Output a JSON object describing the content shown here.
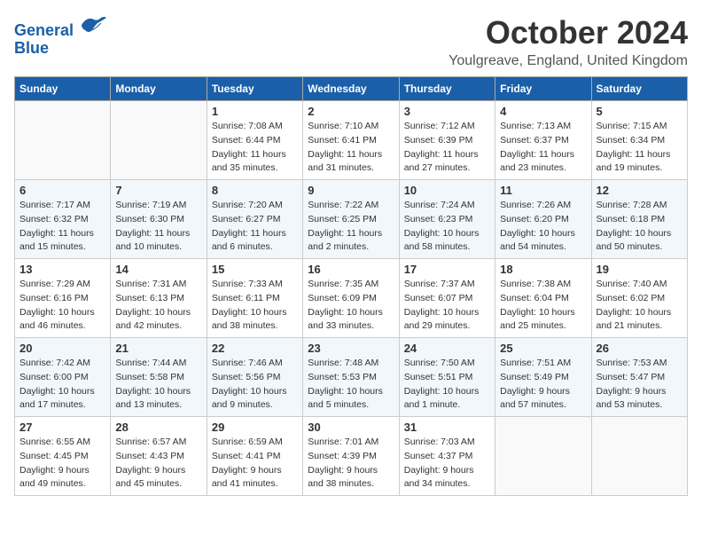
{
  "header": {
    "logo_line1": "General",
    "logo_line2": "Blue",
    "month": "October 2024",
    "location": "Youlgreave, England, United Kingdom"
  },
  "days_of_week": [
    "Sunday",
    "Monday",
    "Tuesday",
    "Wednesday",
    "Thursday",
    "Friday",
    "Saturday"
  ],
  "weeks": [
    [
      {
        "day": "",
        "sunrise": "",
        "sunset": "",
        "daylight": ""
      },
      {
        "day": "",
        "sunrise": "",
        "sunset": "",
        "daylight": ""
      },
      {
        "day": "1",
        "sunrise": "Sunrise: 7:08 AM",
        "sunset": "Sunset: 6:44 PM",
        "daylight": "Daylight: 11 hours and 35 minutes."
      },
      {
        "day": "2",
        "sunrise": "Sunrise: 7:10 AM",
        "sunset": "Sunset: 6:41 PM",
        "daylight": "Daylight: 11 hours and 31 minutes."
      },
      {
        "day": "3",
        "sunrise": "Sunrise: 7:12 AM",
        "sunset": "Sunset: 6:39 PM",
        "daylight": "Daylight: 11 hours and 27 minutes."
      },
      {
        "day": "4",
        "sunrise": "Sunrise: 7:13 AM",
        "sunset": "Sunset: 6:37 PM",
        "daylight": "Daylight: 11 hours and 23 minutes."
      },
      {
        "day": "5",
        "sunrise": "Sunrise: 7:15 AM",
        "sunset": "Sunset: 6:34 PM",
        "daylight": "Daylight: 11 hours and 19 minutes."
      }
    ],
    [
      {
        "day": "6",
        "sunrise": "Sunrise: 7:17 AM",
        "sunset": "Sunset: 6:32 PM",
        "daylight": "Daylight: 11 hours and 15 minutes."
      },
      {
        "day": "7",
        "sunrise": "Sunrise: 7:19 AM",
        "sunset": "Sunset: 6:30 PM",
        "daylight": "Daylight: 11 hours and 10 minutes."
      },
      {
        "day": "8",
        "sunrise": "Sunrise: 7:20 AM",
        "sunset": "Sunset: 6:27 PM",
        "daylight": "Daylight: 11 hours and 6 minutes."
      },
      {
        "day": "9",
        "sunrise": "Sunrise: 7:22 AM",
        "sunset": "Sunset: 6:25 PM",
        "daylight": "Daylight: 11 hours and 2 minutes."
      },
      {
        "day": "10",
        "sunrise": "Sunrise: 7:24 AM",
        "sunset": "Sunset: 6:23 PM",
        "daylight": "Daylight: 10 hours and 58 minutes."
      },
      {
        "day": "11",
        "sunrise": "Sunrise: 7:26 AM",
        "sunset": "Sunset: 6:20 PM",
        "daylight": "Daylight: 10 hours and 54 minutes."
      },
      {
        "day": "12",
        "sunrise": "Sunrise: 7:28 AM",
        "sunset": "Sunset: 6:18 PM",
        "daylight": "Daylight: 10 hours and 50 minutes."
      }
    ],
    [
      {
        "day": "13",
        "sunrise": "Sunrise: 7:29 AM",
        "sunset": "Sunset: 6:16 PM",
        "daylight": "Daylight: 10 hours and 46 minutes."
      },
      {
        "day": "14",
        "sunrise": "Sunrise: 7:31 AM",
        "sunset": "Sunset: 6:13 PM",
        "daylight": "Daylight: 10 hours and 42 minutes."
      },
      {
        "day": "15",
        "sunrise": "Sunrise: 7:33 AM",
        "sunset": "Sunset: 6:11 PM",
        "daylight": "Daylight: 10 hours and 38 minutes."
      },
      {
        "day": "16",
        "sunrise": "Sunrise: 7:35 AM",
        "sunset": "Sunset: 6:09 PM",
        "daylight": "Daylight: 10 hours and 33 minutes."
      },
      {
        "day": "17",
        "sunrise": "Sunrise: 7:37 AM",
        "sunset": "Sunset: 6:07 PM",
        "daylight": "Daylight: 10 hours and 29 minutes."
      },
      {
        "day": "18",
        "sunrise": "Sunrise: 7:38 AM",
        "sunset": "Sunset: 6:04 PM",
        "daylight": "Daylight: 10 hours and 25 minutes."
      },
      {
        "day": "19",
        "sunrise": "Sunrise: 7:40 AM",
        "sunset": "Sunset: 6:02 PM",
        "daylight": "Daylight: 10 hours and 21 minutes."
      }
    ],
    [
      {
        "day": "20",
        "sunrise": "Sunrise: 7:42 AM",
        "sunset": "Sunset: 6:00 PM",
        "daylight": "Daylight: 10 hours and 17 minutes."
      },
      {
        "day": "21",
        "sunrise": "Sunrise: 7:44 AM",
        "sunset": "Sunset: 5:58 PM",
        "daylight": "Daylight: 10 hours and 13 minutes."
      },
      {
        "day": "22",
        "sunrise": "Sunrise: 7:46 AM",
        "sunset": "Sunset: 5:56 PM",
        "daylight": "Daylight: 10 hours and 9 minutes."
      },
      {
        "day": "23",
        "sunrise": "Sunrise: 7:48 AM",
        "sunset": "Sunset: 5:53 PM",
        "daylight": "Daylight: 10 hours and 5 minutes."
      },
      {
        "day": "24",
        "sunrise": "Sunrise: 7:50 AM",
        "sunset": "Sunset: 5:51 PM",
        "daylight": "Daylight: 10 hours and 1 minute."
      },
      {
        "day": "25",
        "sunrise": "Sunrise: 7:51 AM",
        "sunset": "Sunset: 5:49 PM",
        "daylight": "Daylight: 9 hours and 57 minutes."
      },
      {
        "day": "26",
        "sunrise": "Sunrise: 7:53 AM",
        "sunset": "Sunset: 5:47 PM",
        "daylight": "Daylight: 9 hours and 53 minutes."
      }
    ],
    [
      {
        "day": "27",
        "sunrise": "Sunrise: 6:55 AM",
        "sunset": "Sunset: 4:45 PM",
        "daylight": "Daylight: 9 hours and 49 minutes."
      },
      {
        "day": "28",
        "sunrise": "Sunrise: 6:57 AM",
        "sunset": "Sunset: 4:43 PM",
        "daylight": "Daylight: 9 hours and 45 minutes."
      },
      {
        "day": "29",
        "sunrise": "Sunrise: 6:59 AM",
        "sunset": "Sunset: 4:41 PM",
        "daylight": "Daylight: 9 hours and 41 minutes."
      },
      {
        "day": "30",
        "sunrise": "Sunrise: 7:01 AM",
        "sunset": "Sunset: 4:39 PM",
        "daylight": "Daylight: 9 hours and 38 minutes."
      },
      {
        "day": "31",
        "sunrise": "Sunrise: 7:03 AM",
        "sunset": "Sunset: 4:37 PM",
        "daylight": "Daylight: 9 hours and 34 minutes."
      },
      {
        "day": "",
        "sunrise": "",
        "sunset": "",
        "daylight": ""
      },
      {
        "day": "",
        "sunrise": "",
        "sunset": "",
        "daylight": ""
      }
    ]
  ]
}
